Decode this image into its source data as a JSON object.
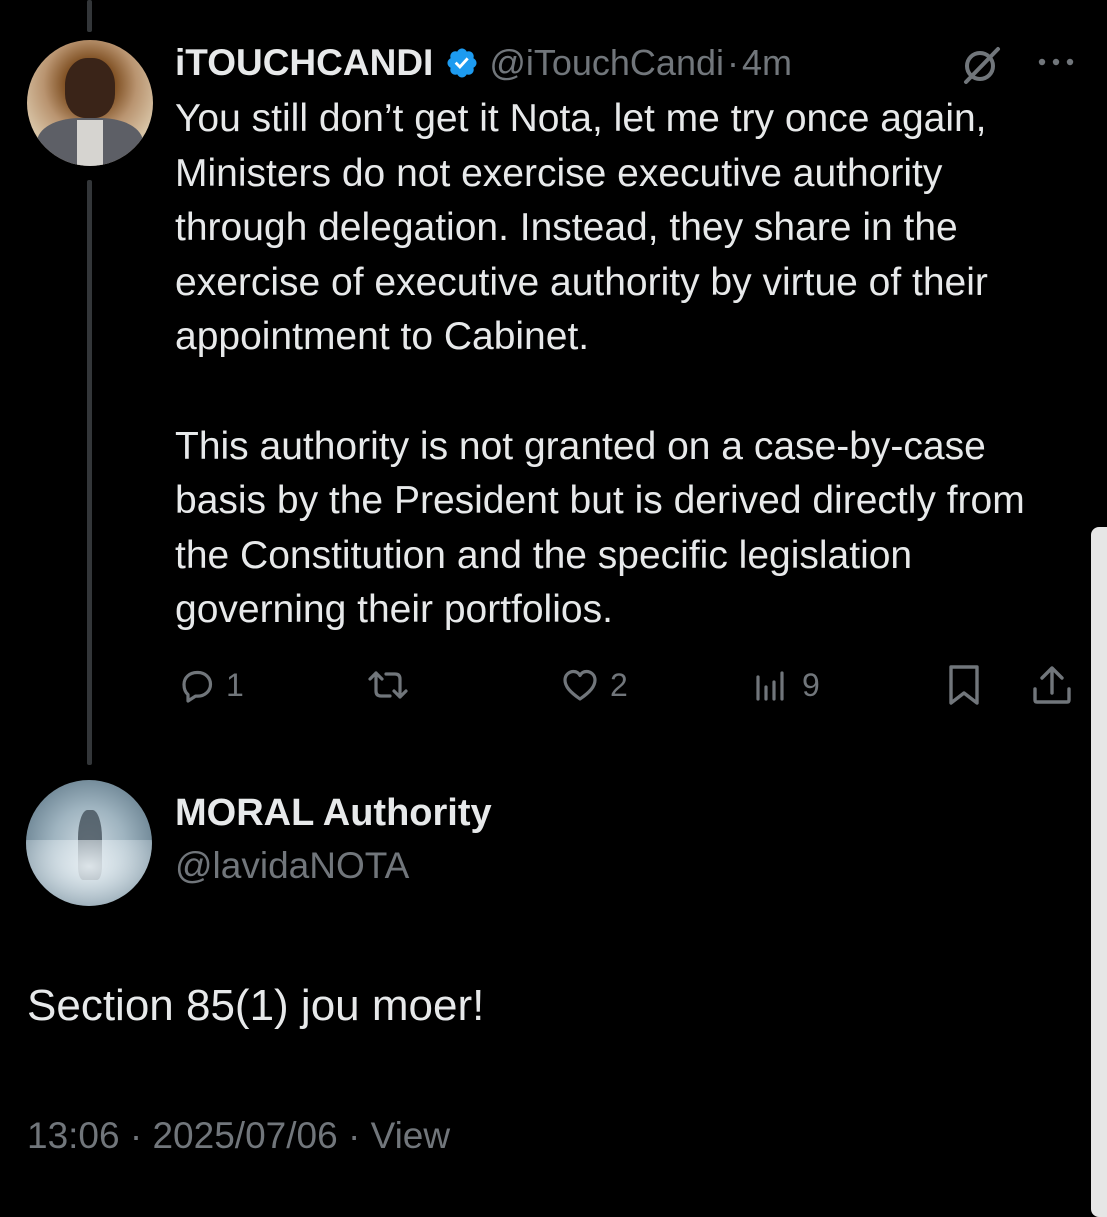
{
  "reply_tweet": {
    "display_name": "iTOUCHCANDI",
    "handle": "@iTouchCandi",
    "separator": "·",
    "time": "4m",
    "paragraphs": [
      "You still don’t get it Nota, let me try once again, Ministers do not exercise executive authority through delegation. Instead, they share in the exercise of executive authority by virtue of their appointment to Cabinet.",
      "This authority is not granted on a case-by-case basis by the President but is derived directly from the Constitution and the specific legislation governing their portfolios."
    ],
    "actions": {
      "reply_count": "1",
      "repost_count": "",
      "like_count": "2",
      "views_count": "9"
    },
    "icons": {
      "verified": "verified-badge-icon",
      "grok": "grok-icon",
      "more": "more-icon",
      "reply": "reply-icon",
      "repost": "repost-icon",
      "like": "heart-icon",
      "views": "views-icon",
      "bookmark": "bookmark-icon",
      "share": "share-icon"
    }
  },
  "main_tweet": {
    "display_name": "MORAL Authority",
    "handle": "@lavidaNOTA",
    "text": "Section 85(1) jou moer!",
    "time": "13:06",
    "separator": "·",
    "date": "2025/07/06",
    "view_label": "View"
  },
  "colors": {
    "background": "#000000",
    "primary_text": "#e7e9ea",
    "secondary_text": "#71767b",
    "verified_blue": "#1d9bf0",
    "thread_line": "#333639"
  }
}
